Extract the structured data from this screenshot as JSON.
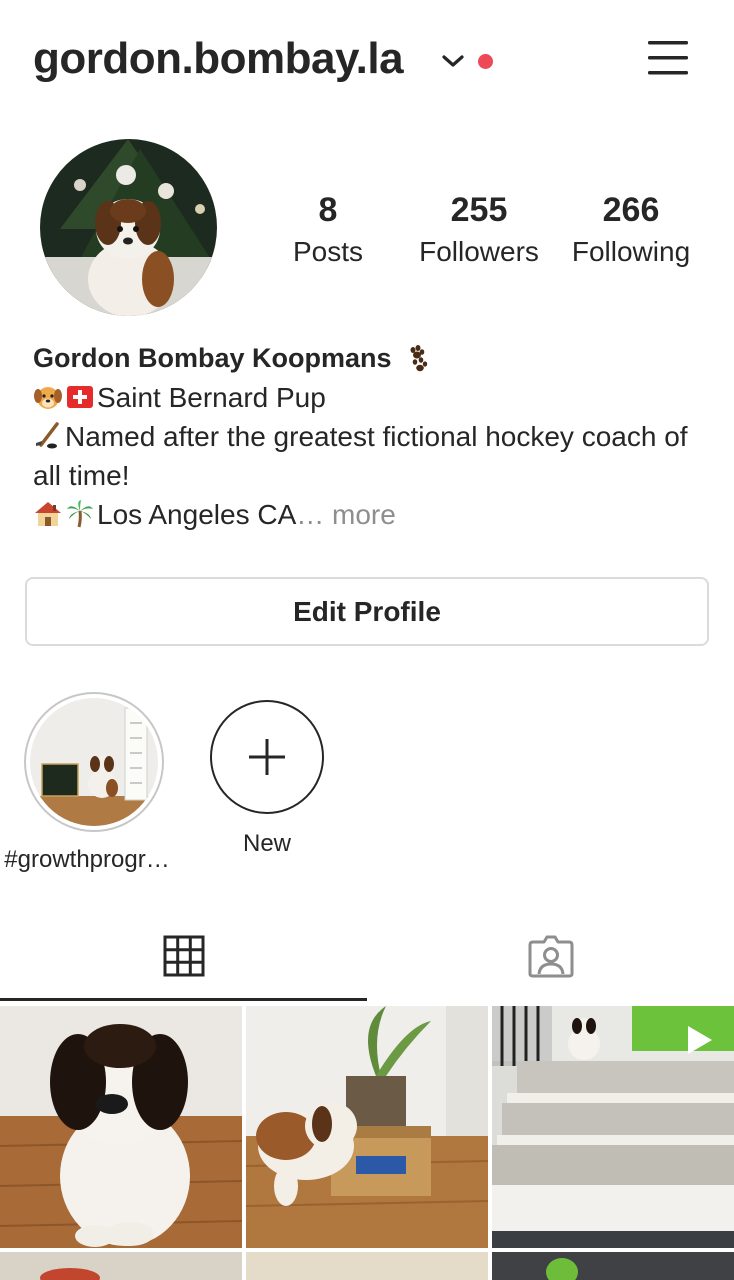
{
  "header": {
    "username": "gordon.bombay.la",
    "notification_dot_color": "#ed4956",
    "dropdown_icon": "chevron-down-icon",
    "menu_icon": "hamburger-menu-icon"
  },
  "profile": {
    "avatar_alt": "Saint Bernard puppy under a Christmas tree",
    "stats": {
      "posts": {
        "count": "8",
        "label": "Posts"
      },
      "followers": {
        "count": "255",
        "label": "Followers"
      },
      "following": {
        "count": "266",
        "label": "Following"
      }
    },
    "display_name": "Gordon Bombay Koopmans",
    "bio_line_1": "Saint Bernard Pup",
    "bio_line_2": "Named after the greatest fictional hockey coach of all time!",
    "bio_line_3": "Los Angeles CA",
    "bio_ellipsis": "…",
    "bio_more": "more",
    "emojis": [
      "paw-prints",
      "dog-face",
      "swiss-flag",
      "hockey-stick",
      "house",
      "palm-tree"
    ]
  },
  "actions": {
    "edit_profile": "Edit Profile"
  },
  "highlights": [
    {
      "label": "#growthprogr…"
    },
    {
      "label": "New",
      "icon": "plus-icon"
    }
  ],
  "tabs": [
    {
      "name": "grid",
      "icon": "grid-icon",
      "active": true
    },
    {
      "name": "tagged",
      "icon": "tagged-person-icon",
      "active": false
    }
  ],
  "posts": [
    {
      "subject": "puppy sitting on wood floor"
    },
    {
      "subject": "puppy with Chewy box"
    },
    {
      "subject": "puppy on porch steps",
      "is_video": true
    }
  ]
}
